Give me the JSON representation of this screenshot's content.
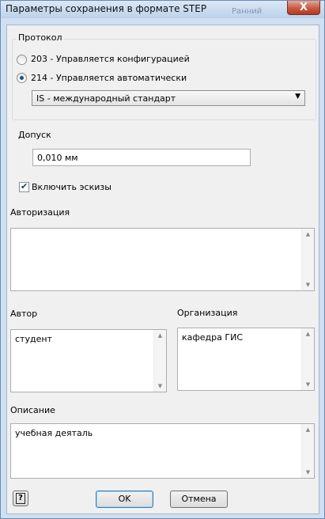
{
  "window": {
    "title": "Параметры сохранения в формате STEP",
    "background_title": "Ранний",
    "close_label": "X"
  },
  "protocol": {
    "label": "Протокол",
    "options": [
      {
        "label": "203 - Управляется конфигурацией",
        "selected": false
      },
      {
        "label": "214 - Управляется автоматически",
        "selected": true
      }
    ],
    "standard": "IS - международный стандарт"
  },
  "tolerance": {
    "label": "Допуск",
    "value": "0,010 мм"
  },
  "sketches": {
    "label": "Включить эскизы",
    "checked": true
  },
  "authorization": {
    "label": "Авторизация",
    "value": ""
  },
  "author": {
    "label": "Автор",
    "value": "студент"
  },
  "organization": {
    "label": "Организация",
    "value": "кафедра ГИС"
  },
  "description": {
    "label": "Описание",
    "value": "учебная деяталь"
  },
  "buttons": {
    "help": "?",
    "ok": "OK",
    "cancel": "Отмена"
  },
  "icons": {
    "up_arrow": "▲",
    "down_arrow": "▼",
    "dropdown_arrow": "▼",
    "checkmark": "✔"
  }
}
